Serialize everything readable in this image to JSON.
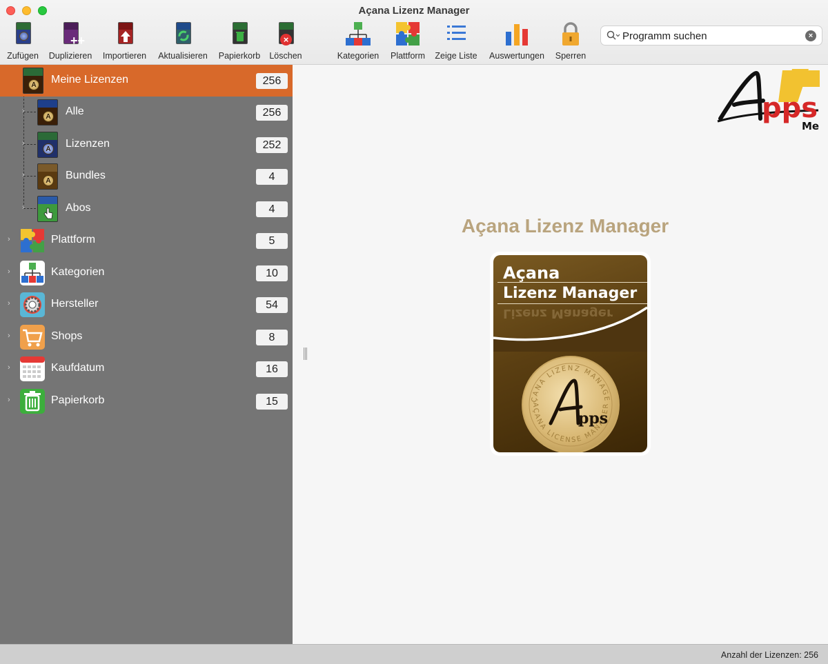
{
  "window": {
    "title": "Açana Lizenz Manager"
  },
  "toolbar": {
    "add": "Zufügen",
    "duplicate": "Duplizieren",
    "import": "Importieren",
    "update": "Aktualisieren",
    "trash": "Papierkorb",
    "delete": "Löschen",
    "categories": "Kategorien",
    "platform": "Plattform",
    "show_list": "Zeige Liste",
    "reports": "Auswertungen",
    "lock": "Sperren"
  },
  "search": {
    "placeholder": "Programm suchen",
    "value": ""
  },
  "sidebar": {
    "items": [
      {
        "label": "Meine Lizenzen",
        "count": "256"
      },
      {
        "label": "Alle",
        "count": "256"
      },
      {
        "label": "Lizenzen",
        "count": "252"
      },
      {
        "label": "Bundles",
        "count": "4"
      },
      {
        "label": "Abos",
        "count": "4"
      },
      {
        "label": "Plattform",
        "count": "5"
      },
      {
        "label": "Kategorien",
        "count": "10"
      },
      {
        "label": "Hersteller",
        "count": "54"
      },
      {
        "label": "Shops",
        "count": "8"
      },
      {
        "label": "Kaufdatum",
        "count": "16"
      },
      {
        "label": "Papierkorb",
        "count": "15"
      }
    ]
  },
  "main": {
    "title": "Açana Lizenz Manager",
    "logo_line1": "Açana",
    "logo_line2": "Lizenz Manager",
    "seal_top_text": "AÇANA LIZENZ MANAGER",
    "seal_bottom_text": "AÇANA LICENSE MANAGER",
    "seal_mark": "pps"
  },
  "brand": {
    "apps_logo_text": "pps",
    "apps_logo_suffix": "Me"
  },
  "status": {
    "text": "Anzahl der Lizenzen: 256"
  },
  "colors": {
    "selection": "#d8692a",
    "sidebar": "#757575",
    "title_gold": "#b9a47e"
  }
}
